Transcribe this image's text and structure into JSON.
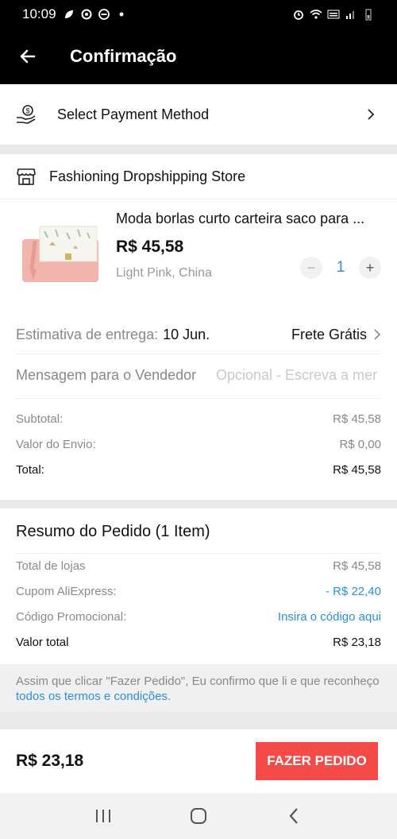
{
  "status_bar": {
    "time": "10:09",
    "left_icons": [
      "leaf-icon",
      "refresh-icon",
      "minus-circle-icon",
      "dot-icon"
    ],
    "right_icons": [
      "alarm-icon",
      "wifi-icon",
      "volte-lte-icon",
      "signal-icon",
      "battery-icon"
    ]
  },
  "app_bar": {
    "title": "Confirmação",
    "back_icon": "arrow-left-icon"
  },
  "payment": {
    "label": "Select Payment Method",
    "icon": "hand-coin-icon",
    "chevron": "chevron-right-icon"
  },
  "store": {
    "name": "Fashioning Dropshipping Store",
    "icon": "store-icon"
  },
  "product": {
    "title": "Moda borlas curto carteira saco para ...",
    "price": "R$ 45,58",
    "variant": "Light Pink, China",
    "quantity": "1",
    "minus_label": "−",
    "plus_label": "+"
  },
  "delivery": {
    "estimate_label": "Estimativa de entrega:",
    "estimate_date": "10 Jun.",
    "shipping": "Frete Grátis"
  },
  "message": {
    "label": "Mensagem para o Vendedor",
    "placeholder": "Opcional - Escreva a mer"
  },
  "totals": {
    "subtotal_label": "Subtotal:",
    "subtotal": "R$ 45,58",
    "shipping_label": "Valor do Envio:",
    "shipping": "R$ 0,00",
    "total_label": "Total:",
    "total": "R$ 45,58"
  },
  "summary": {
    "heading": "Resumo do Pedido (1 Item)",
    "stores_label": "Total de lojas",
    "stores_value": "R$ 45,58",
    "coupon_label": "Cupom AliExpress:",
    "coupon_value": "- R$ 22,40",
    "promo_label": "Código Promocional:",
    "promo_value": "Insira o código aqui",
    "grand_label": "Valor total",
    "grand_value": "R$ 23,18"
  },
  "terms": {
    "text_before": "Assim que clicar \"Fazer Pedido\", Eu confirmo que li e que reconheço ",
    "link": "todos os termos e condições",
    "text_after": "."
  },
  "footer": {
    "total": "R$ 23,18",
    "button": "FAZER PEDIDO"
  },
  "colors": {
    "accent_blue": "#2a8fd6",
    "order_button": "#f44a48",
    "header": "#000000"
  }
}
